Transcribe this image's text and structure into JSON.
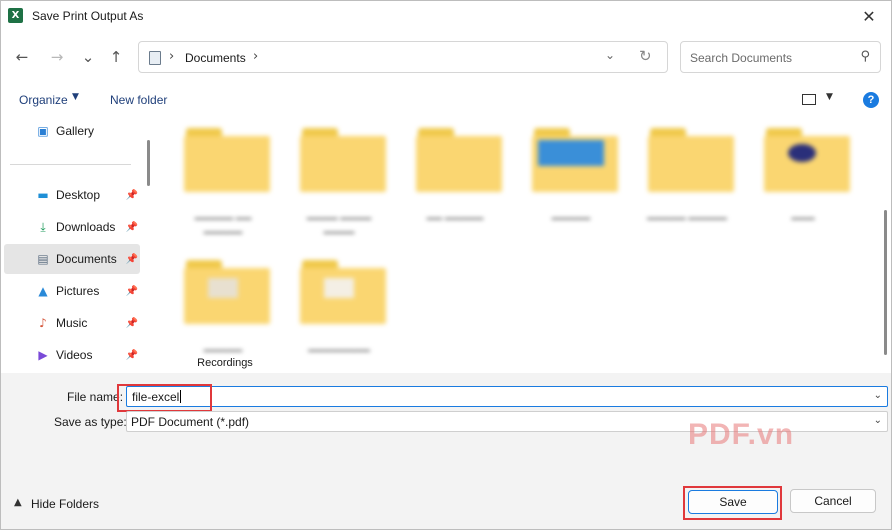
{
  "window": {
    "title": "Save Print Output As",
    "app_icon_letter": "X",
    "close_glyph": "✕"
  },
  "nav": {
    "back_glyph": "←",
    "forward_glyph": "→",
    "recent_glyph": "⌄",
    "up_glyph": "↑",
    "breadcrumb": [
      "Documents"
    ],
    "separator_glyph": "›",
    "dropdown_glyph": "⌄",
    "refresh_glyph": "↻",
    "search_placeholder": "Search Documents",
    "search_glyph": "⚲"
  },
  "toolbar": {
    "organize_label": "Organize",
    "organize_caret": "▼",
    "new_folder_label": "New folder",
    "view_caret": "▼",
    "help_label": "?"
  },
  "sidebar": {
    "pin_glyph": "📌",
    "items": [
      {
        "label": "Gallery",
        "icon": "gallery-icon",
        "glyph": "▣",
        "color": "#2a7fd4",
        "pinned": false,
        "selected": false
      },
      {
        "label": "Desktop",
        "icon": "desktop-icon",
        "glyph": "▬",
        "color": "#1f8fd6",
        "pinned": true,
        "selected": false
      },
      {
        "label": "Downloads",
        "icon": "downloads-icon",
        "glyph": "⤓",
        "color": "#1b9a5a",
        "pinned": true,
        "selected": false
      },
      {
        "label": "Documents",
        "icon": "documents-icon",
        "glyph": "▤",
        "color": "#5d6f82",
        "pinned": true,
        "selected": true
      },
      {
        "label": "Pictures",
        "icon": "pictures-icon",
        "glyph": "▲",
        "color": "#2a8ad8",
        "pinned": true,
        "selected": false
      },
      {
        "label": "Music",
        "icon": "music-icon",
        "glyph": "♪",
        "color": "#d4553a",
        "pinned": true,
        "selected": false
      },
      {
        "label": "Videos",
        "icon": "videos-icon",
        "glyph": "▶",
        "color": "#7a4ad8",
        "pinned": true,
        "selected": false
      }
    ]
  },
  "content": {
    "readable_label": "Recordings"
  },
  "fields": {
    "file_name_label": "File name:",
    "file_name_value": "file-excel",
    "save_as_type_label": "Save as type:",
    "save_as_type_value": "PDF Document (*.pdf)",
    "dropdown_glyph": "⌄"
  },
  "footer": {
    "hide_folders_label": "Hide Folders",
    "hide_caret": "▲",
    "save_label": "Save",
    "cancel_label": "Cancel"
  },
  "watermark": "PDF.vn",
  "colors": {
    "accent": "#1a7be0",
    "highlight": "#e0383b",
    "folder": "#fad671",
    "excel": "#1e7145"
  }
}
